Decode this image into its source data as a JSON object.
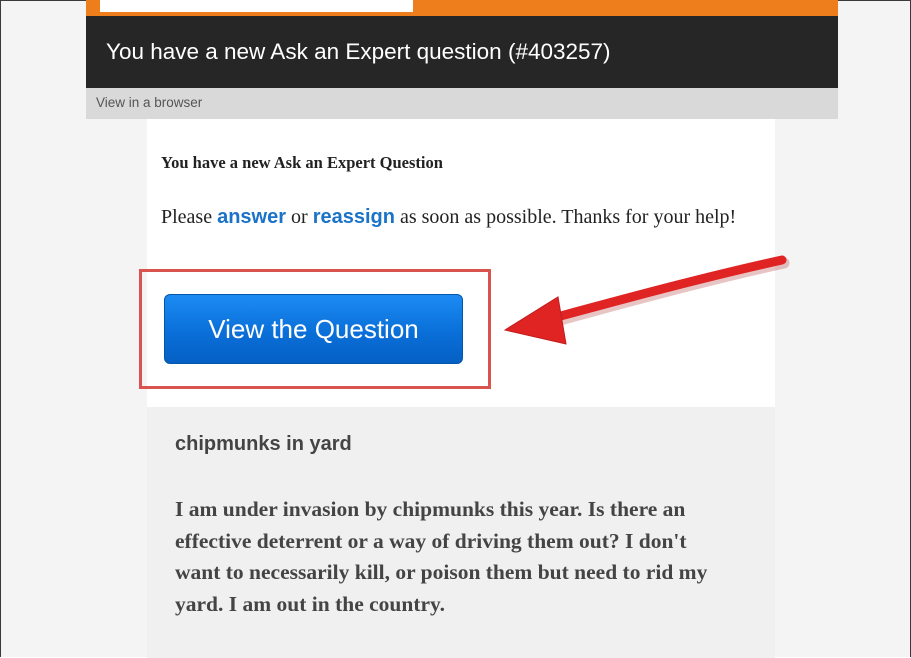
{
  "email": {
    "header_title": "You have a new Ask an Expert question (#403257)",
    "view_in_browser": "View in a browser",
    "content_title": "You have a new Ask an Expert Question",
    "text_prefix": "Please ",
    "answer_link": "answer",
    "text_or": " or ",
    "reassign_link": "reassign",
    "text_suffix": " as soon as possible. Thanks for your help!",
    "button_label": "View the Question",
    "question_title": "chipmunks in yard",
    "question_body": "I am under invasion by chipmunks this year. Is there an effective deterrent or a way of driving them out? I don't want to necessarily kill, or poison them but need to rid my yard. I am out in the country."
  },
  "colors": {
    "accent_orange": "#ee7d1c",
    "header_bg": "#262626",
    "link_blue": "#1a73c8",
    "button_blue": "#0a6fd9",
    "annotation_red": "#e02424"
  },
  "icons": {
    "annotation": "red-arrow-icon"
  }
}
